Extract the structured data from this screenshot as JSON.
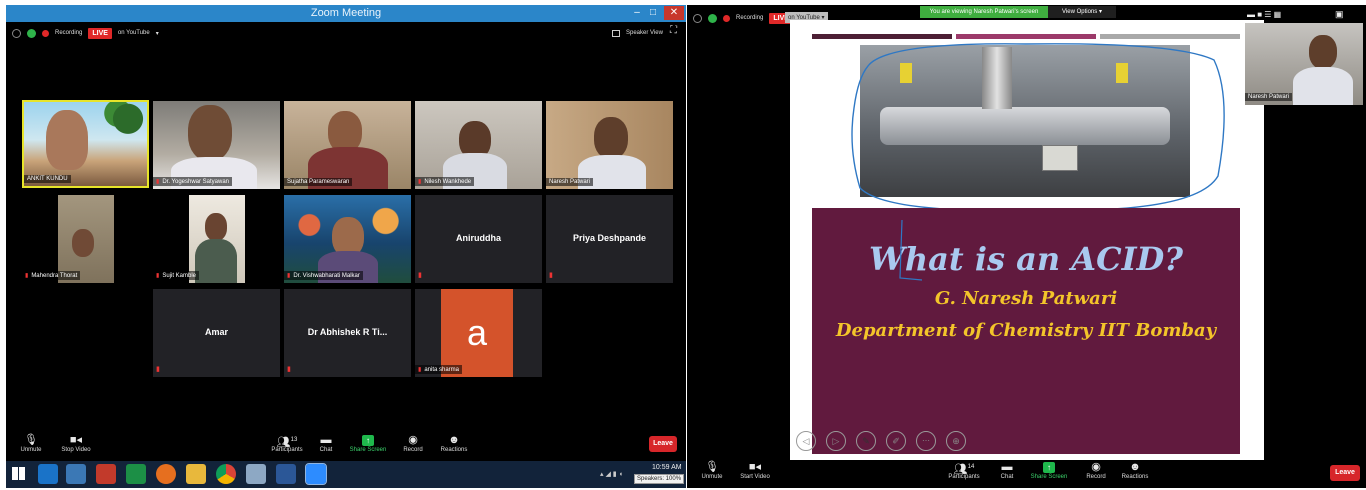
{
  "left": {
    "window_title": "Zoom Meeting",
    "recording": "Recording",
    "live": "LIVE",
    "youtube": "on YouTube",
    "speaker_view": "Speaker View",
    "participants": [
      "ANKIT KUNDU",
      "Dr. Yogeshwar Satyawan",
      "Sujatha Parameswaran",
      "Nilesh Wankhede",
      "Naresh Patwari",
      "Mahendra Thorat",
      "Sujit Kamble",
      "Dr. Vishwabharati Malkar",
      "Aniruddha",
      "Priya Deshpande",
      "Amar",
      "Dr Abhishek R Ti...",
      "anita sharma"
    ],
    "avatar_letter": "a",
    "toolbar": {
      "unmute": "Unmute",
      "stop_video": "Stop Video",
      "participants": "Participants",
      "participants_count": "13",
      "chat": "Chat",
      "share_screen": "Share Screen",
      "record": "Record",
      "reactions": "Reactions",
      "leave": "Leave"
    },
    "taskbar": {
      "time": "10:59 AM",
      "speakers_tooltip": "Speakers: 100%"
    }
  },
  "right": {
    "recording": "Recording",
    "live": "LIVE",
    "youtube": "on YouTube",
    "viewing_banner": "You are viewing Naresh Patwari's screen",
    "view_options": "View Options",
    "self_view_name": "Naresh Patwari",
    "slide": {
      "title": "What is an ACID?",
      "author": "G. Naresh Patwari",
      "department": "Department of Chemistry IIT Bombay"
    },
    "toolbar": {
      "unmute": "Unmute",
      "start_video": "Start Video",
      "participants": "Participants",
      "participants_count": "14",
      "chat": "Chat",
      "share_screen": "Share Screen",
      "record": "Record",
      "reactions": "Reactions",
      "leave": "Leave"
    }
  },
  "colors": {
    "zoom_blue": "#2b86c9",
    "live_red": "#e02828",
    "share_green": "#1fb84c",
    "leave_red": "#d7262a",
    "slide_maroon": "#611a3e",
    "slide_text_blue": "#a9c9ef",
    "slide_text_yellow": "#f3c52a",
    "active_speaker": "#e7e42a",
    "avatar_orange": "#d4532b"
  }
}
